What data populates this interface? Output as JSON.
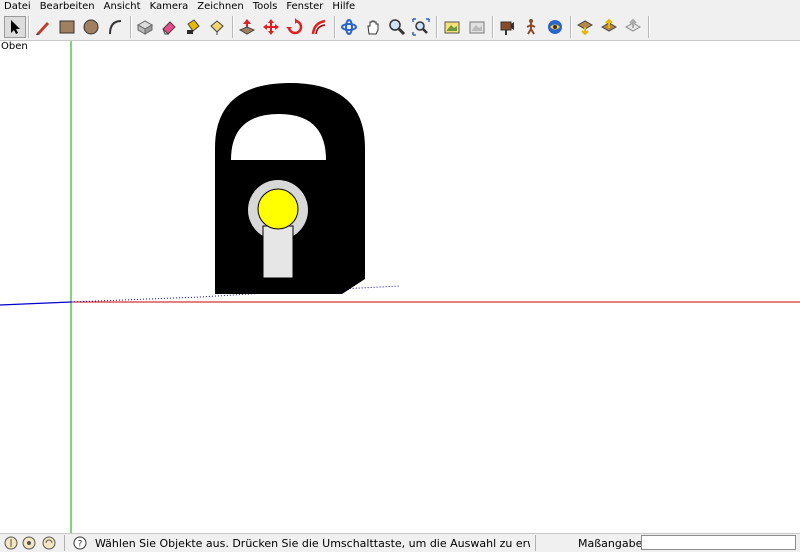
{
  "menu": {
    "items": [
      "Datei",
      "Bearbeiten",
      "Ansicht",
      "Kamera",
      "Zeichnen",
      "Tools",
      "Fenster",
      "Hilfe"
    ]
  },
  "toolbar": {
    "tools": [
      "select-icon",
      "pencil-icon",
      "rectangle-icon",
      "circle-icon",
      "arc-icon",
      "make-component-icon",
      "eraser-icon",
      "paint-bucket-icon",
      "push-pull-icon",
      "move-icon",
      "rotate-icon",
      "follow-me-icon",
      "orbit-icon",
      "pan-icon",
      "zoom-icon",
      "zoom-extents-icon",
      "previous-view-icon",
      "next-view-icon",
      "position-camera-icon",
      "walk-icon",
      "look-around-icon",
      "get-models-icon",
      "share-model-icon",
      "share-component-icon"
    ]
  },
  "viewport": {
    "view_name": "Oben"
  },
  "status": {
    "hint": "Wählen Sie Objekte aus. Drücken Sie die Umschalttaste, um die Auswahl zu erweitern. Ziehen S",
    "measure_label": "Maßangaben",
    "measure_value": ""
  },
  "colors": {
    "menu_bg": "#f0f0f0",
    "lock_body": "#000000",
    "keyhole_ring": "#d8d8d8",
    "keyhole_center": "#ffff00",
    "keyhole_slot": "#e6e6e6",
    "axis_red": "#cc0000",
    "axis_green": "#00aa00",
    "axis_blue": "#0000cc"
  }
}
